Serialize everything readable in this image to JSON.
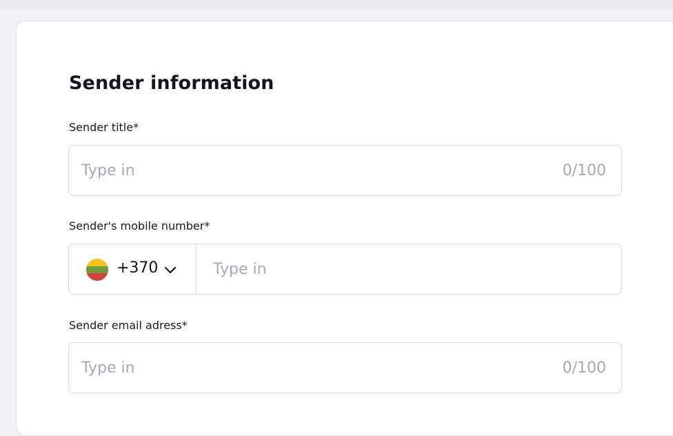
{
  "section": {
    "title": "Sender information"
  },
  "fields": {
    "sender_title": {
      "label": "Sender title*",
      "placeholder": "Type in",
      "counter": "0/100",
      "value": ""
    },
    "mobile": {
      "label": "Sender's mobile number*",
      "country_flag": "lithuania-flag-icon",
      "dial_code": "+370",
      "placeholder": "Type in",
      "value": ""
    },
    "email": {
      "label": "Sender email adress*",
      "placeholder": "Type in",
      "counter": "0/100",
      "value": ""
    }
  },
  "colors": {
    "border": "#d9d9de",
    "placeholder": "#a9a9b0",
    "text": "#15151b",
    "flag_yellow": "#f7c31a",
    "flag_green": "#6f9b3a",
    "flag_red": "#d2443a"
  }
}
